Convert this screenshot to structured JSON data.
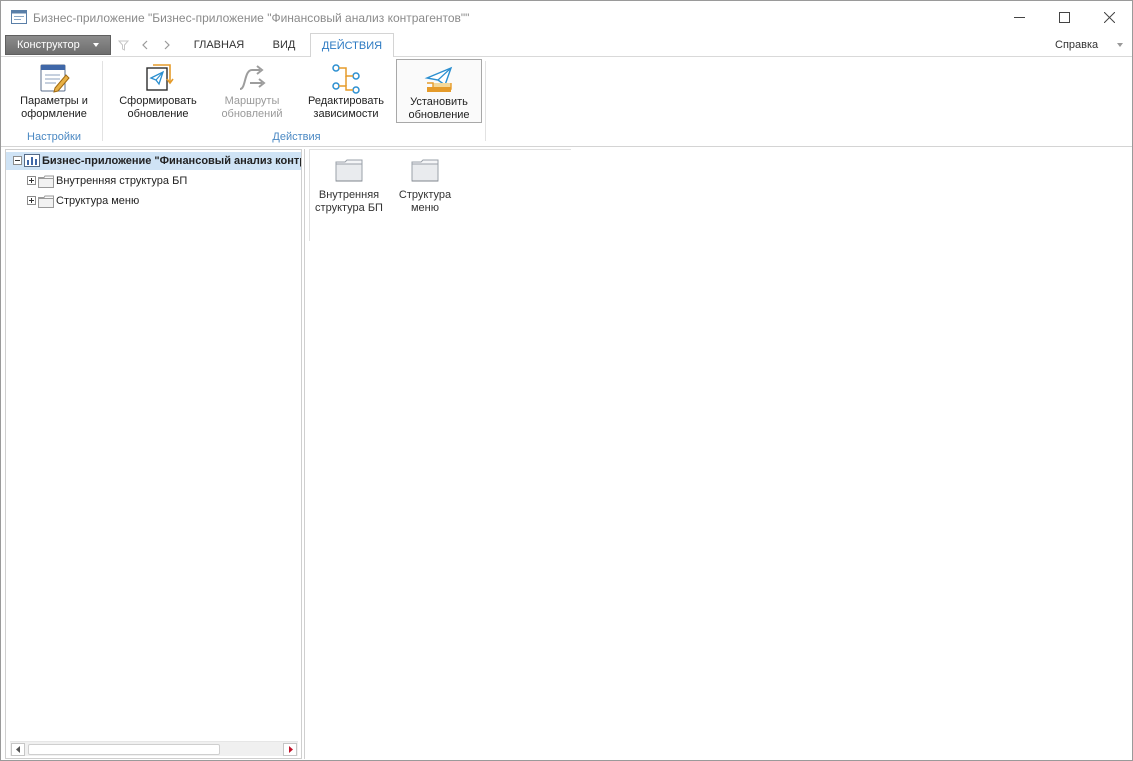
{
  "window": {
    "title": "Бизнес-приложение \"Бизнес-приложение \"Финансовый анализ контрагентов\"\"",
    "minimize_icon": "minimize-icon",
    "maximize_icon": "maximize-icon",
    "close_icon": "close-icon"
  },
  "tabbar": {
    "designer_label": "Конструктор",
    "quick_access": [
      "filter-icon",
      "back-icon",
      "forward-icon"
    ],
    "tabs": [
      {
        "label": "ГЛАВНАЯ",
        "active": false
      },
      {
        "label": "ВИД",
        "active": false
      },
      {
        "label": "ДЕЙСТВИЯ",
        "active": true
      }
    ],
    "help_label": "Справка"
  },
  "ribbon": {
    "groups": [
      {
        "label": "Настройки",
        "buttons": [
          {
            "line1": "Параметры и",
            "line2": "оформление",
            "icon": "settings-form-icon",
            "enabled": true
          }
        ]
      },
      {
        "label": "Действия",
        "buttons": [
          {
            "line1": "Сформировать",
            "line2": "обновление",
            "icon": "create-update-icon",
            "enabled": true
          },
          {
            "line1": "Маршруты",
            "line2": "обновлений",
            "icon": "update-routes-icon",
            "enabled": false
          },
          {
            "line1": "Редактировать",
            "line2": "зависимости",
            "icon": "edit-dependencies-icon",
            "enabled": true
          },
          {
            "line1": "Установить",
            "line2": "обновление",
            "icon": "install-update-icon",
            "enabled": true
          }
        ]
      }
    ]
  },
  "tree": {
    "root": "Бизнес-приложение \"Финансовый анализ контрагентов\"",
    "children": [
      {
        "label": "Внутренняя структура БП"
      },
      {
        "label": "Структура меню"
      }
    ]
  },
  "content": {
    "items": [
      {
        "line1": "Внутренняя",
        "line2": "структура БП",
        "icon": "folder-icon"
      },
      {
        "line1": "Структура",
        "line2": "меню",
        "icon": "folder-icon"
      }
    ]
  },
  "colors": {
    "accent": "#2b79c2",
    "group_label": "#4a88c3",
    "selection": "#cfe3f5",
    "designer_button": "#7a7a7a"
  }
}
